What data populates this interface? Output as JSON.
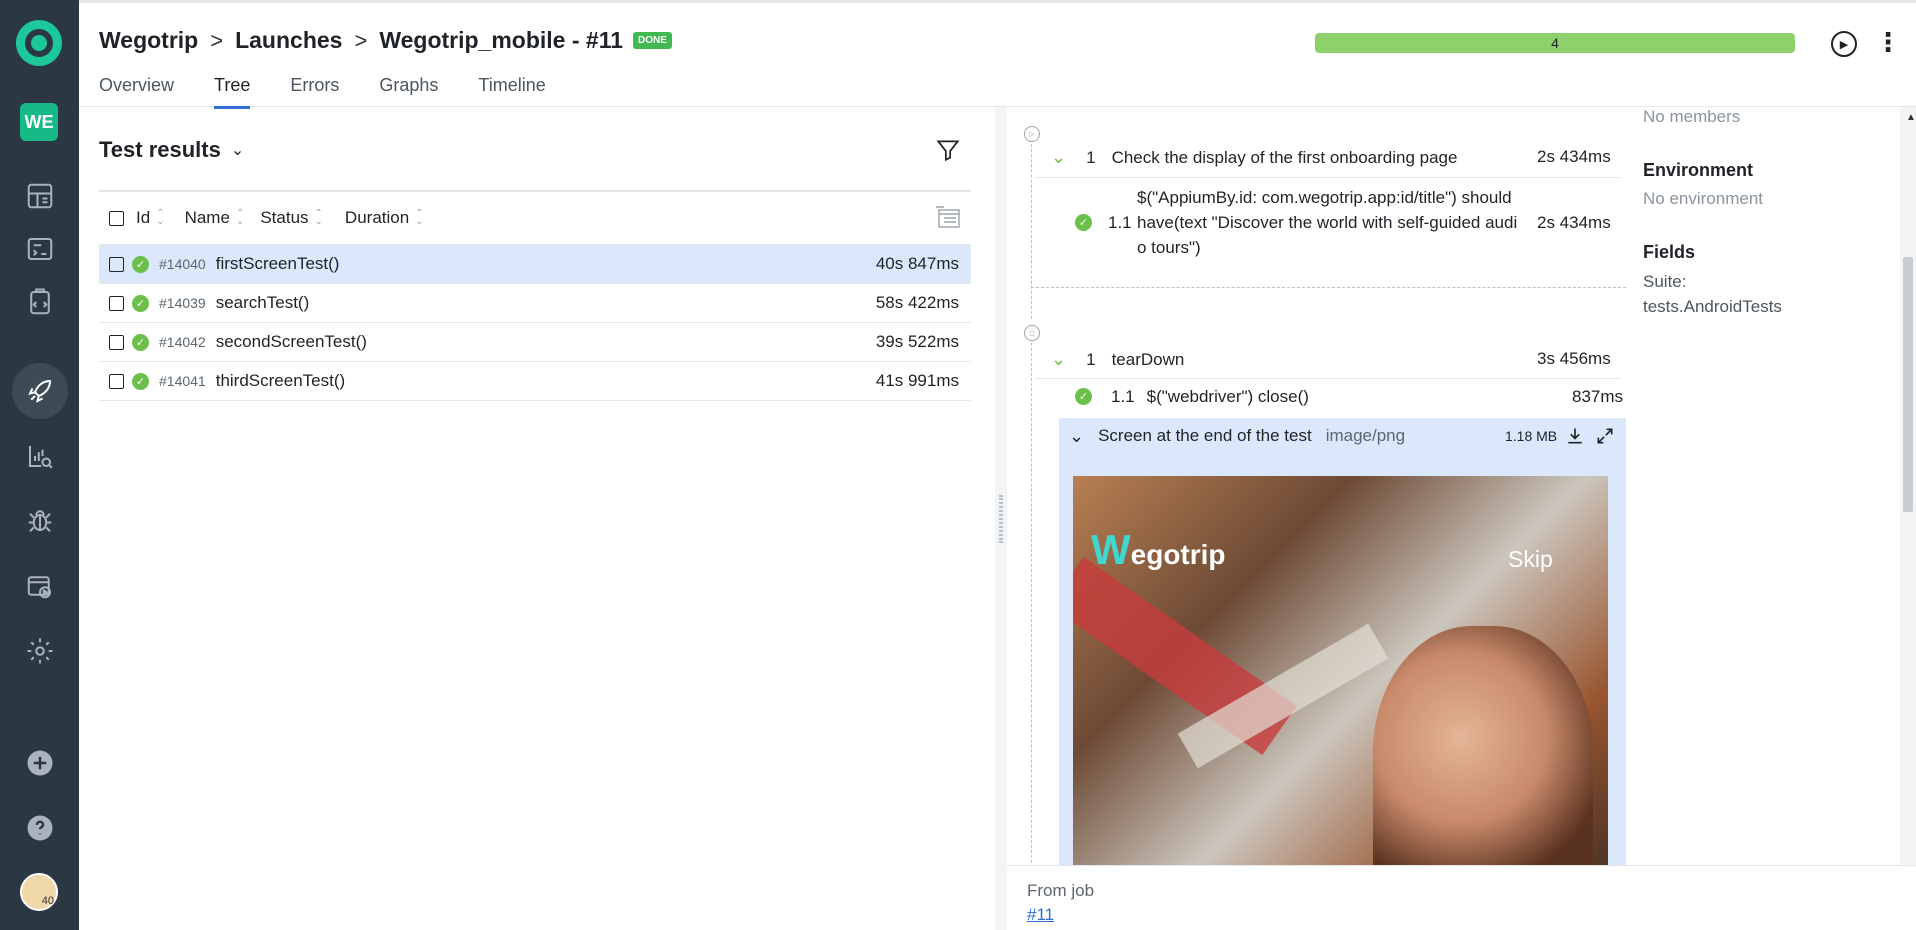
{
  "sidebar": {
    "project_initials": "WE",
    "items": [
      "dashboard-icon",
      "testcases-icon",
      "testplans-icon",
      "launches-icon",
      "analytics-icon",
      "defects-icon",
      "jobs-icon",
      "settings-icon"
    ],
    "bottom": [
      "add-icon",
      "help-icon"
    ],
    "avatar_text": "40"
  },
  "header": {
    "breadcrumbs": [
      "Wegotrip",
      "Launches",
      "Wegotrip_mobile - #11"
    ],
    "badge": "DONE",
    "tabs": [
      "Overview",
      "Tree",
      "Errors",
      "Graphs",
      "Timeline"
    ],
    "active_tab": "Tree",
    "progress_value": "4",
    "progress_fraction": 1.0,
    "progress_color": "#8dd06c"
  },
  "results": {
    "title": "Test results",
    "columns": [
      "Id",
      "Name",
      "Status",
      "Duration"
    ],
    "rows": [
      {
        "id": "#14040",
        "name": "firstScreenTest()",
        "duration": "40s 847ms",
        "status": "passed"
      },
      {
        "id": "#14039",
        "name": "searchTest()",
        "duration": "58s 422ms",
        "status": "passed"
      },
      {
        "id": "#14042",
        "name": "secondScreenTest()",
        "duration": "39s 522ms",
        "status": "passed"
      },
      {
        "id": "#14041",
        "name": "thirdScreenTest()",
        "duration": "41s 991ms",
        "status": "passed"
      }
    ]
  },
  "test": {
    "step1": {
      "num": "1",
      "label": "Check the display of the first onboarding page",
      "duration": "2s 434ms"
    },
    "step1_1": {
      "num": "1.1",
      "lines": [
        "$(\"AppiumBy.id: com.wegotrip.app:id/title\") should",
        "have(text \"Discover the world with self-guided audi",
        "o tours\")"
      ],
      "duration": "2s 434ms"
    },
    "teardown": {
      "num": "1",
      "label": "tearDown",
      "duration": "3s 456ms"
    },
    "teardown_1": {
      "num": "1.1",
      "label": "$(\"webdriver\") close()",
      "duration": "837ms"
    },
    "attachment": {
      "name": "Screen at the end of the test",
      "type": "image/png",
      "size": "1.18 MB"
    },
    "screenshot": {
      "logo_mark": "W",
      "logo_text": "egotrip",
      "skip": "Skip"
    }
  },
  "from_job": {
    "label": "From job",
    "link": "#11"
  },
  "details": {
    "members_value": "No members",
    "environment_title": "Environment",
    "environment_value": "No environment",
    "fields_title": "Fields",
    "suite_label": "Suite:",
    "suite_value": "tests.AndroidTests"
  },
  "colors": {
    "sidebar": "#2b3843",
    "accent": "#2e6ed6",
    "passed": "#6cc04a",
    "selected_row": "#dbe8fb",
    "brand": "#1cc79a"
  }
}
